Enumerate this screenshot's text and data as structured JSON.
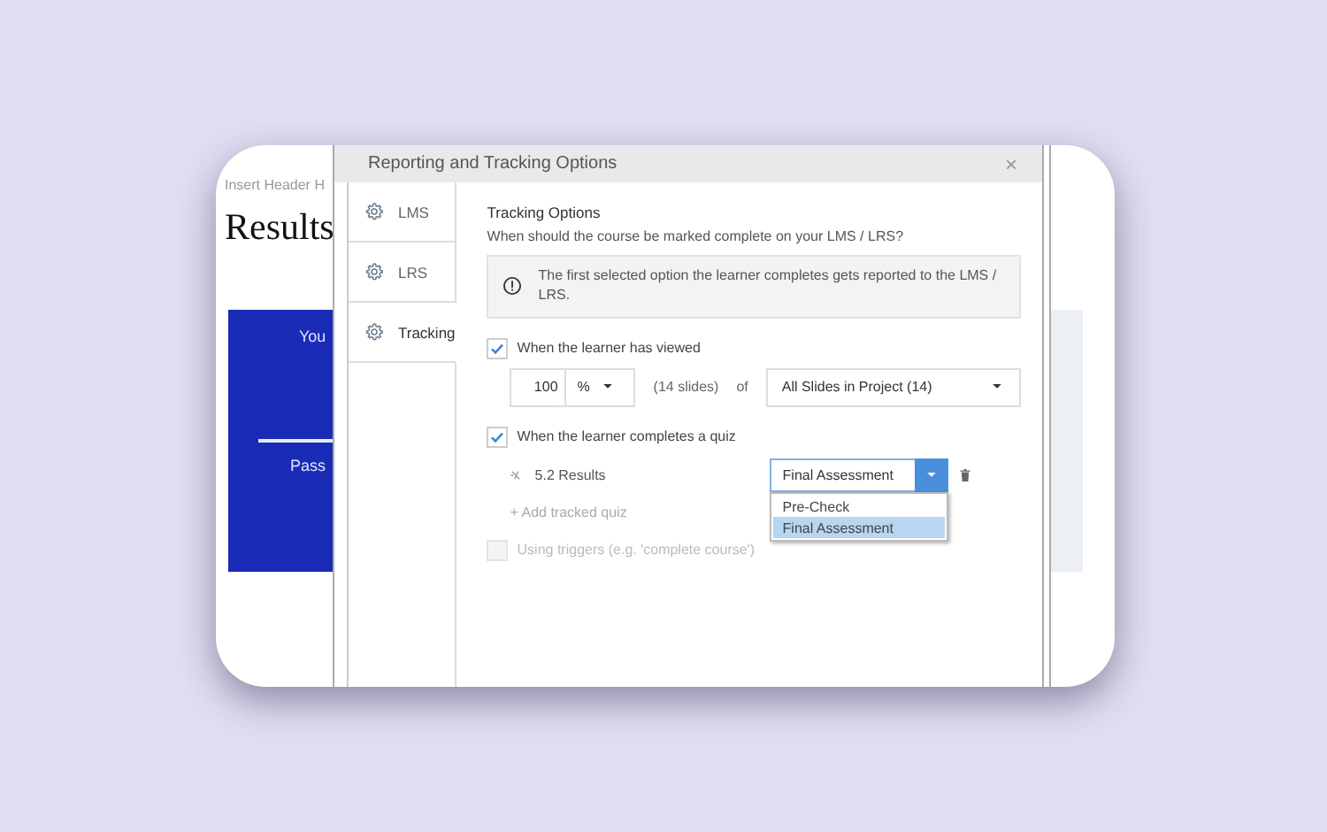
{
  "slide": {
    "header": "Insert Header H",
    "title": "Results",
    "panel_texts": [
      "You",
      "Pass"
    ]
  },
  "dialog": {
    "title": "Reporting and Tracking Options",
    "close": "×"
  },
  "sidebar": [
    {
      "label": "LMS",
      "selected": false
    },
    {
      "label": "LRS",
      "selected": false
    },
    {
      "label": "Tracking",
      "selected": true
    }
  ],
  "section": {
    "heading": "Tracking Options",
    "question": "When should the course be marked complete on your LMS / LRS?",
    "info": "The first selected option the learner completes gets reported to the LMS / LRS."
  },
  "viewed": {
    "label": "When the learner has viewed",
    "checked": true,
    "amount": "100",
    "unit": "%",
    "slides": "(14 slides)",
    "of": "of",
    "scope": "All Slides in Project (14)"
  },
  "quiz": {
    "label": "When the learner completes a quiz",
    "checked": true,
    "quiz_name": "5.2 Results",
    "selection": "Final Assessment",
    "options": [
      {
        "label": "Pre-Check",
        "selected": false
      },
      {
        "label": "Final Assessment",
        "selected": true
      }
    ],
    "add": "+ Add tracked quiz"
  },
  "triggers": {
    "label": "Using triggers (e.g. 'complete course')",
    "checked": false,
    "disabled": true
  }
}
